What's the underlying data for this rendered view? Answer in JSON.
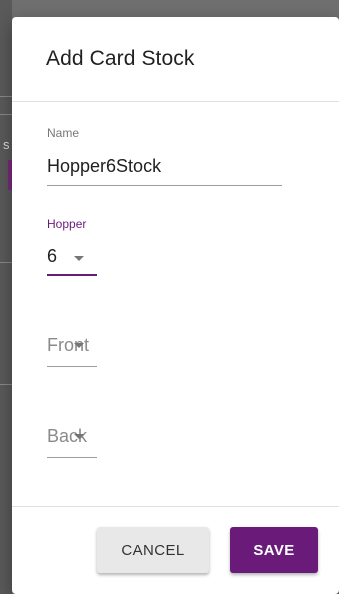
{
  "background": {
    "partial_label": "s"
  },
  "dialog": {
    "title": "Add Card Stock",
    "fields": {
      "name": {
        "label": "Name",
        "value": "Hopper6Stock"
      },
      "hopper": {
        "label": "Hopper",
        "value": "6"
      },
      "front": {
        "placeholder": "Front"
      },
      "back": {
        "placeholder": "Back"
      }
    },
    "buttons": {
      "cancel": "CANCEL",
      "save": "SAVE"
    }
  },
  "colors": {
    "accent": "#6a1b7a",
    "overlay": "#6f6f6f"
  }
}
